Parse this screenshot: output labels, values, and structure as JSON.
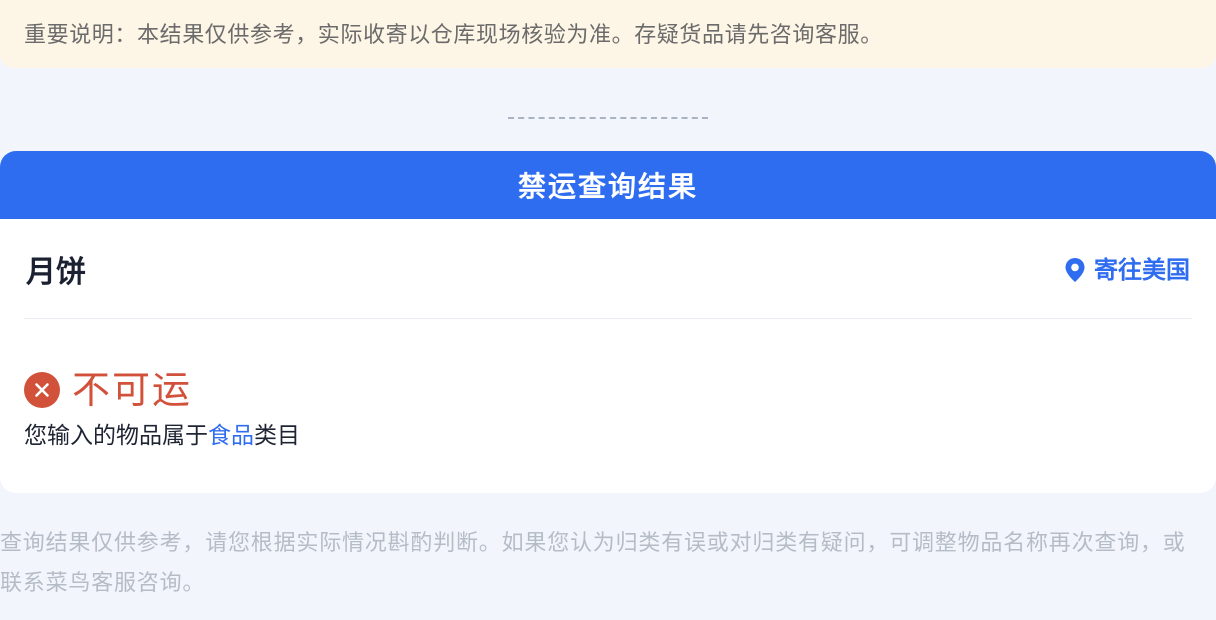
{
  "notice": {
    "text": "重要说明：本结果仅供参考，实际收寄以仓库现场核验为准。存疑货品请先咨询客服。"
  },
  "result_card": {
    "title": "禁运查询结果",
    "item_name": "月饼",
    "destination_icon": "location-pin-icon",
    "destination": "寄往美国",
    "status_icon": "close-circle-icon",
    "status": "不可运",
    "category_prefix": "您输入的物品属于",
    "category": "食品",
    "category_suffix": "类目"
  },
  "disclaimer": {
    "text": "查询结果仅供参考，请您根据实际情况斟酌判断。如果您认为归类有误或对归类有疑问，可调整物品名称再次查询，或联系菜鸟客服咨询。"
  },
  "colors": {
    "accent": "#2e6cf0",
    "error": "#d2513b",
    "notice_bg": "#fdf5e6",
    "page_bg": "#f2f6fc"
  }
}
